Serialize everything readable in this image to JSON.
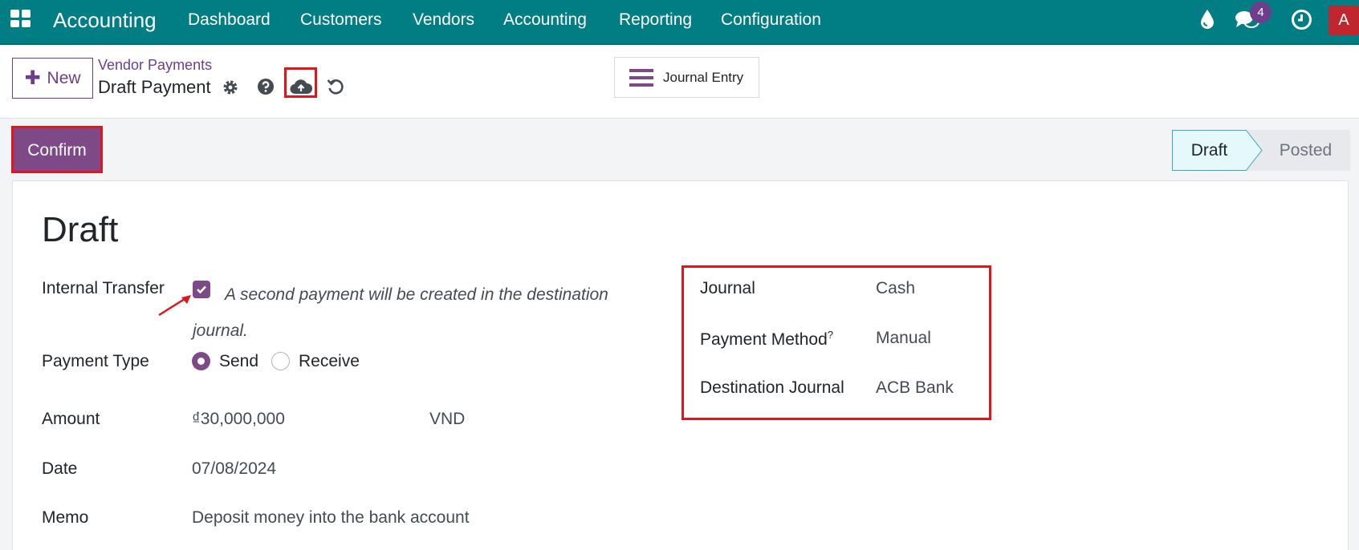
{
  "topnav": {
    "app_title": "Accounting",
    "menu": [
      "Dashboard",
      "Customers",
      "Vendors",
      "Accounting",
      "Reporting",
      "Configuration"
    ],
    "chat_badge": "4",
    "avatar_letter": "A",
    "icons": [
      "apps-icon",
      "drop-icon",
      "chat-icon",
      "clock-icon"
    ]
  },
  "control_panel": {
    "new_label": "New",
    "breadcrumb_parent": "Vendor Payments",
    "breadcrumb_current": "Draft Payment",
    "journal_entry_label": "Journal Entry"
  },
  "statusbar": {
    "confirm_label": "Confirm",
    "stages": [
      "Draft",
      "Posted"
    ],
    "active_stage": "Draft"
  },
  "form": {
    "title": "Draft",
    "internal_transfer_label": "Internal Transfer",
    "internal_transfer_checked": true,
    "internal_transfer_hint": "A second payment will be created in the destination journal.",
    "payment_type_label": "Payment Type",
    "payment_type_options": [
      "Send",
      "Receive"
    ],
    "payment_type_selected": "Send",
    "amount_label": "Amount",
    "amount_value": "₫30,000,000",
    "currency": "VND",
    "date_label": "Date",
    "date_value": "07/08/2024",
    "memo_label": "Memo",
    "memo_value": "Deposit money into the bank account",
    "journal_label": "Journal",
    "journal_value": "Cash",
    "payment_method_label": "Payment Method",
    "payment_method_tooltip": "?",
    "payment_method_value": "Manual",
    "destination_journal_label": "Destination Journal",
    "destination_journal_value": "ACB Bank"
  },
  "colors": {
    "navbar": "#017e84",
    "primary": "#7d4a87",
    "highlight": "#e0161c"
  }
}
